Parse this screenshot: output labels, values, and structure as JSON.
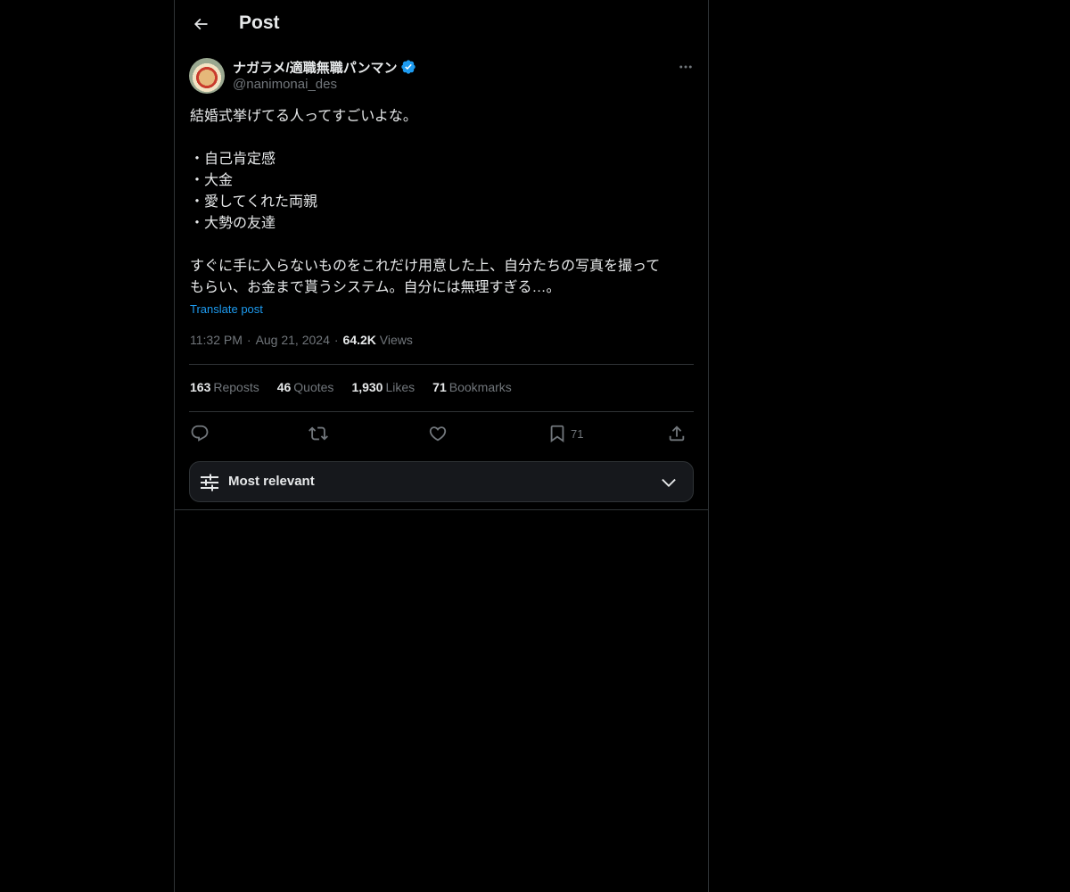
{
  "header": {
    "title": "Post"
  },
  "author": {
    "display_name": "ナガラメ/適職無職パンマン",
    "handle": "@nanimonai_des",
    "verified": true
  },
  "post": {
    "text": "結婚式挙げてる人ってすごいよな。\n\n・自己肯定感\n・大金\n・愛してくれた両親\n・大勢の友達\n\nすぐに手に入らないものをこれだけ用意した上、自分たちの写真を撮って\nもらい、お金まで貰うシステム。自分には無理すぎる…。",
    "translate_label": "Translate post",
    "time": "11:32 PM",
    "date": "Aug 21, 2024",
    "views_count": "64.2K",
    "views_label": "Views",
    "separator": "·"
  },
  "stats": {
    "reposts": {
      "count": "163",
      "label": "Reposts"
    },
    "quotes": {
      "count": "46",
      "label": "Quotes"
    },
    "likes": {
      "count": "1,930",
      "label": "Likes"
    },
    "bookmarks": {
      "count": "71",
      "label": "Bookmarks"
    }
  },
  "actions": {
    "reply_icon": "reply-icon",
    "repost_icon": "repost-icon",
    "like_icon": "heart-icon",
    "bookmark_icon": "bookmark-icon",
    "bookmark_count": "71",
    "share_icon": "share-icon"
  },
  "replies_filter": {
    "label": "Most relevant"
  },
  "colors": {
    "background": "#000000",
    "text": "#e7e9ea",
    "muted": "#71767b",
    "accent": "#1d9bf0",
    "border": "#2f3336"
  }
}
